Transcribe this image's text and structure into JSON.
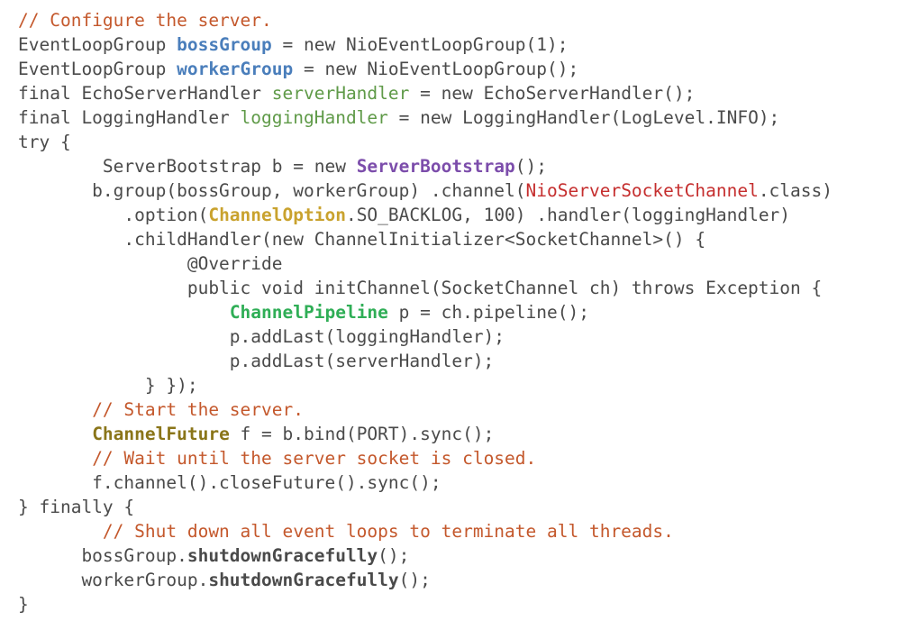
{
  "document": {
    "kind": "source-code-listing",
    "language": "Java",
    "background_color": "#ffffff",
    "default_text_color": "#4a4a4a"
  },
  "palette": {
    "plain": "#4a4a4a",
    "comment": "#c4582c",
    "variable_blue": "#4a7ebb",
    "field_green": "#5f9a48",
    "type_purple": "#7c4dab",
    "type_gold": "#c9a22e",
    "type_red": "#c52e2e",
    "type_bright_green": "#2fae56",
    "type_olive": "#8a7519",
    "method_bold": "#4a4a4a"
  },
  "code": {
    "lines": [
      {
        "id": "line-1",
        "tokens": [
          {
            "text": "// Configure the server.",
            "style": "t-comment"
          }
        ]
      },
      {
        "id": "line-2",
        "tokens": [
          {
            "text": "EventLoopGroup ",
            "style": "t-plain"
          },
          {
            "text": "bossGroup",
            "style": "t-var"
          },
          {
            "text": " = new NioEventLoopGroup(1);",
            "style": "t-plain"
          }
        ]
      },
      {
        "id": "line-3",
        "tokens": [
          {
            "text": "EventLoopGroup ",
            "style": "t-plain"
          },
          {
            "text": "workerGroup",
            "style": "t-var"
          },
          {
            "text": " = new NioEventLoopGroup();",
            "style": "t-plain"
          }
        ]
      },
      {
        "id": "line-4",
        "tokens": [
          {
            "text": "final EchoServerHandler ",
            "style": "t-plain"
          },
          {
            "text": "serverHandler",
            "style": "t-field"
          },
          {
            "text": " = new EchoServerHandler();",
            "style": "t-plain"
          }
        ]
      },
      {
        "id": "line-5",
        "tokens": [
          {
            "text": "final LoggingHandler ",
            "style": "t-plain"
          },
          {
            "text": "loggingHandler",
            "style": "t-field"
          },
          {
            "text": " = new LoggingHandler(LogLevel.INFO);",
            "style": "t-plain"
          }
        ]
      },
      {
        "id": "line-6",
        "tokens": [
          {
            "text": "try {",
            "style": "t-plain"
          }
        ]
      },
      {
        "id": "line-7",
        "tokens": [
          {
            "text": "        ServerBootstrap b = new ",
            "style": "t-plain"
          },
          {
            "text": "ServerBootstrap",
            "style": "t-purple"
          },
          {
            "text": "();",
            "style": "t-plain"
          }
        ]
      },
      {
        "id": "line-8",
        "tokens": [
          {
            "text": "       b.group(bossGroup, workerGroup) .channel(",
            "style": "t-plain"
          },
          {
            "text": "NioServerSocketChannel",
            "style": "t-red"
          },
          {
            "text": ".class)",
            "style": "t-plain"
          }
        ]
      },
      {
        "id": "line-9",
        "tokens": [
          {
            "text": "          .option(",
            "style": "t-plain"
          },
          {
            "text": "ChannelOption",
            "style": "t-gold"
          },
          {
            "text": ".SO_BACKLOG, 100) .handler(loggingHandler)",
            "style": "t-plain"
          }
        ]
      },
      {
        "id": "line-10",
        "tokens": [
          {
            "text": "          .childHandler(new ChannelInitializer<SocketChannel>() {",
            "style": "t-plain"
          }
        ]
      },
      {
        "id": "line-11",
        "tokens": [
          {
            "text": "                @Override",
            "style": "t-plain"
          }
        ]
      },
      {
        "id": "line-12",
        "tokens": [
          {
            "text": "                public void initChannel(SocketChannel ch) throws Exception {",
            "style": "t-plain"
          }
        ]
      },
      {
        "id": "line-13",
        "tokens": [
          {
            "text": "                    ",
            "style": "t-plain"
          },
          {
            "text": "ChannelPipeline",
            "style": "t-green"
          },
          {
            "text": " p = ch.pipeline();",
            "style": "t-plain"
          }
        ]
      },
      {
        "id": "line-14",
        "tokens": [
          {
            "text": "                    p.addLast(loggingHandler);",
            "style": "t-plain"
          }
        ]
      },
      {
        "id": "line-15",
        "tokens": [
          {
            "text": "                    p.addLast(serverHandler);",
            "style": "t-plain"
          }
        ]
      },
      {
        "id": "line-16",
        "tokens": [
          {
            "text": "            } });",
            "style": "t-plain"
          }
        ]
      },
      {
        "id": "line-17",
        "tokens": [
          {
            "text": "       ",
            "style": "t-plain"
          },
          {
            "text": "// Start the server.",
            "style": "t-comment"
          }
        ]
      },
      {
        "id": "line-18",
        "tokens": [
          {
            "text": "       ",
            "style": "t-plain"
          },
          {
            "text": "ChannelFuture",
            "style": "t-olive"
          },
          {
            "text": " f = b.bind(PORT).sync();",
            "style": "t-plain"
          }
        ]
      },
      {
        "id": "line-19",
        "tokens": [
          {
            "text": "       ",
            "style": "t-plain"
          },
          {
            "text": "// Wait until the server socket is closed.",
            "style": "t-comment"
          }
        ]
      },
      {
        "id": "line-20",
        "tokens": [
          {
            "text": "       f.channel().closeFuture().sync();",
            "style": "t-plain"
          }
        ]
      },
      {
        "id": "line-21",
        "tokens": [
          {
            "text": "} finally {",
            "style": "t-plain"
          }
        ]
      },
      {
        "id": "line-22",
        "tokens": [
          {
            "text": "        ",
            "style": "t-plain"
          },
          {
            "text": "// Shut down all event loops to terminate all threads.",
            "style": "t-comment"
          }
        ]
      },
      {
        "id": "line-23",
        "tokens": [
          {
            "text": "      bossGroup.",
            "style": "t-plain"
          },
          {
            "text": "shutdownGracefully",
            "style": "t-bold"
          },
          {
            "text": "();",
            "style": "t-plain"
          }
        ]
      },
      {
        "id": "line-24",
        "tokens": [
          {
            "text": "      workerGroup.",
            "style": "t-plain"
          },
          {
            "text": "shutdownGracefully",
            "style": "t-bold"
          },
          {
            "text": "();",
            "style": "t-plain"
          }
        ]
      },
      {
        "id": "line-25",
        "tokens": [
          {
            "text": "}",
            "style": "t-plain"
          }
        ]
      }
    ]
  }
}
